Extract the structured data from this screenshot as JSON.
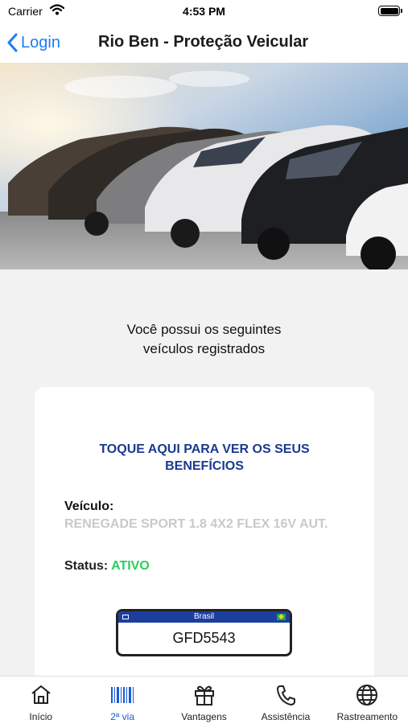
{
  "status_bar": {
    "carrier": "Carrier",
    "time": "4:53 PM"
  },
  "nav": {
    "back_label": "Login",
    "title": "Rio Ben - Proteção Veicular"
  },
  "hero": {
    "image": "parked-cars-photo"
  },
  "intro": {
    "line1": "Você possui os seguintes",
    "line2": "veículos registrados"
  },
  "card": {
    "benefits_line1": "TOQUE AQUI PARA VER OS SEUS",
    "benefits_line2": "BENEFÍCIOS",
    "vehicle_label": "Veículo:",
    "vehicle_value": "RENEGADE SPORT 1.8 4X2 FLEX 16V AUT.",
    "status_label": "Status:",
    "status_value": "ATIVO",
    "plate": {
      "country": "Brasil",
      "number": "GFD5543"
    }
  },
  "tabs": [
    {
      "label": "Início",
      "icon": "home-icon",
      "active": false
    },
    {
      "label": "2ª via",
      "icon": "barcode-icon",
      "active": true
    },
    {
      "label": "Vantagens",
      "icon": "gift-icon",
      "active": false
    },
    {
      "label": "Assistência",
      "icon": "phone-icon",
      "active": false
    },
    {
      "label": "Rastreamento",
      "icon": "globe-icon",
      "active": false
    }
  ],
  "colors": {
    "accent": "#1a7ef5",
    "benefits_link": "#1b3a8f",
    "status_active": "#2ecc5f",
    "plate_band": "#1c3f9e",
    "tab_active": "#1a5bd9"
  }
}
